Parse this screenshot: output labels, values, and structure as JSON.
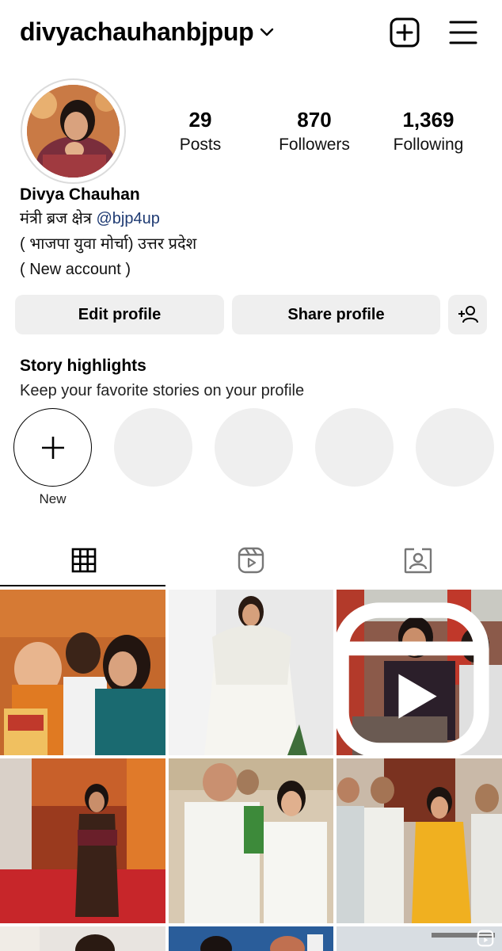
{
  "profile": {
    "username": "divyachauhanbjpup",
    "display_name": "Divya Chauhan",
    "bio_line1_prefix": "मंत्री ब्रज क्षेत्र ",
    "bio_line1_mention": "@bjp4up",
    "bio_line2": "( भाजपा युवा मोर्चा) उत्तर प्रदेश",
    "bio_line3": "( New account )"
  },
  "stats": [
    {
      "value": "29",
      "label": "Posts"
    },
    {
      "value": "870",
      "label": "Followers"
    },
    {
      "value": "1,369",
      "label": "Following"
    }
  ],
  "buttons": {
    "edit": "Edit profile",
    "share": "Share profile"
  },
  "highlights": {
    "title": "Story highlights",
    "subtitle": "Keep your favorite stories on your profile",
    "new_label": "New",
    "empty_slots": 4
  },
  "tabs": [
    {
      "icon": "grid-icon",
      "active": true
    },
    {
      "icon": "reels-icon",
      "active": false
    },
    {
      "icon": "tagged-icon",
      "active": false
    }
  ],
  "icons": {
    "top_add": "add-post-icon",
    "top_menu": "hamburger-menu-icon",
    "dropdown": "chevron-down-icon",
    "add_user": "add-user-icon",
    "reel_badge": "reel-badge-icon"
  },
  "colors": {
    "button_bg": "#efefef",
    "mention": "#1f3b73",
    "text": "#000000"
  },
  "posts": [
    {
      "kind": "photo"
    },
    {
      "kind": "photo"
    },
    {
      "kind": "reel"
    },
    {
      "kind": "photo"
    },
    {
      "kind": "photo"
    },
    {
      "kind": "photo"
    },
    {
      "kind": "photo"
    },
    {
      "kind": "photo"
    },
    {
      "kind": "reel"
    }
  ]
}
